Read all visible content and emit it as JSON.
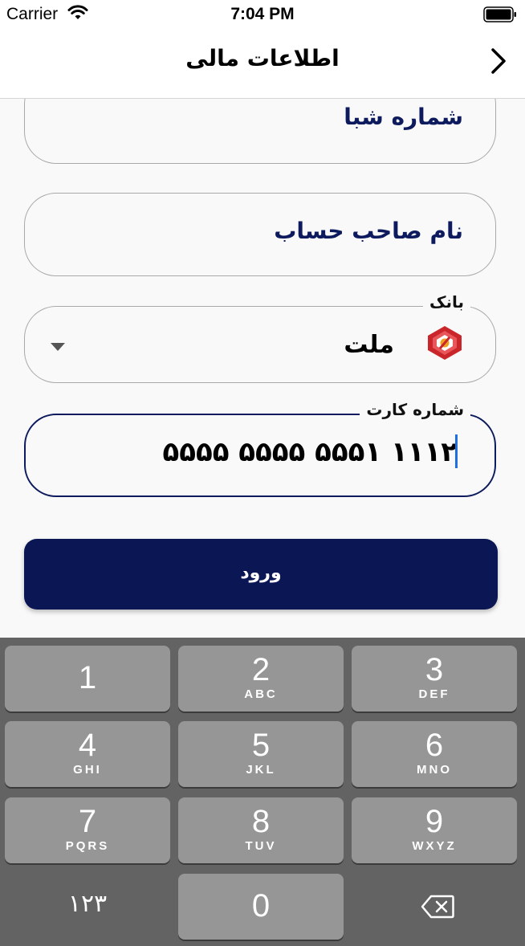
{
  "status_bar": {
    "carrier": "Carrier",
    "time": "7:04 PM"
  },
  "nav": {
    "title": "اطلاعات مالی"
  },
  "form": {
    "sheba_field": {
      "value": "شماره شبا"
    },
    "owner_field": {
      "value": "نام صاحب حساب"
    },
    "bank_field": {
      "label": "بانک",
      "value": "ملت"
    },
    "card_field": {
      "label": "شماره کارت",
      "value": "۵۵۵۵ ۵۵۵۵ ۵۵۵۱ ۱۱۱۲"
    },
    "submit_label": "ورود"
  },
  "keyboard": {
    "keys": [
      {
        "num": "1",
        "letters": ""
      },
      {
        "num": "2",
        "letters": "ABC"
      },
      {
        "num": "3",
        "letters": "DEF"
      },
      {
        "num": "4",
        "letters": "GHI"
      },
      {
        "num": "5",
        "letters": "JKL"
      },
      {
        "num": "6",
        "letters": "MNO"
      },
      {
        "num": "7",
        "letters": "PQRS"
      },
      {
        "num": "8",
        "letters": "TUV"
      },
      {
        "num": "9",
        "letters": "WXYZ"
      }
    ],
    "switch_label": "۱۲۳",
    "zero": "0"
  },
  "colors": {
    "primary": "#0b1654",
    "text_accent": "#0d1b5e",
    "keyboard_bg": "#636363",
    "key_bg": "#969696",
    "bank_logo": "#d02b2f"
  }
}
